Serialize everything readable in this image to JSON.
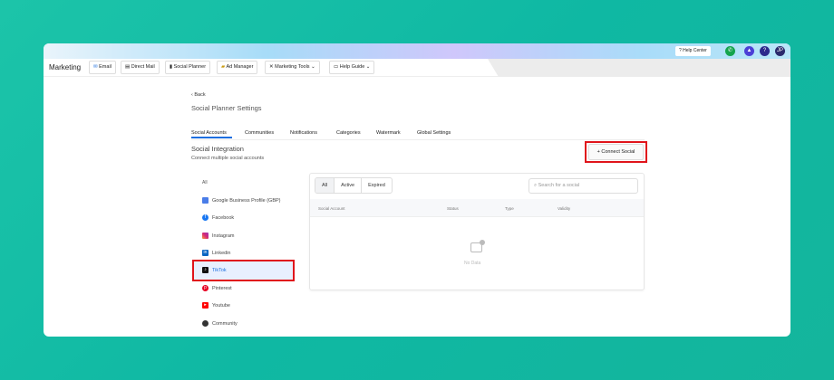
{
  "topbar": {
    "help_center": "? Help Center",
    "avatar": "JP",
    "help_icon": "?"
  },
  "nav": {
    "brand": "Marketing",
    "items": [
      "Email",
      "Direct Mail",
      "Social Planner",
      "Ad Manager",
      "Marketing Tools",
      "Help Guide"
    ]
  },
  "page": {
    "back": "Back",
    "title": "Social Planner Settings"
  },
  "tabs": [
    "Social Accounts",
    "Communities",
    "Notifications",
    "Categories",
    "Watermark",
    "Global Settings"
  ],
  "section": {
    "title": "Social Integration",
    "subtitle": "Connect multiple social accounts",
    "connect_button": "+ Connect Social"
  },
  "platforms": [
    "All",
    "Google Business Profile (GBP)",
    "Facebook",
    "Instagram",
    "Linkedin",
    "TikTok",
    "Pinterest",
    "Youtube",
    "Community"
  ],
  "filters": [
    "All",
    "Active",
    "Expired"
  ],
  "search": {
    "placeholder": "Search for a social"
  },
  "table": {
    "columns": [
      "Social Account",
      "Status",
      "Type",
      "Validity"
    ],
    "empty": "No Data"
  },
  "colors": {
    "accent": "#1d6fe0",
    "highlight": "#e0141b"
  }
}
